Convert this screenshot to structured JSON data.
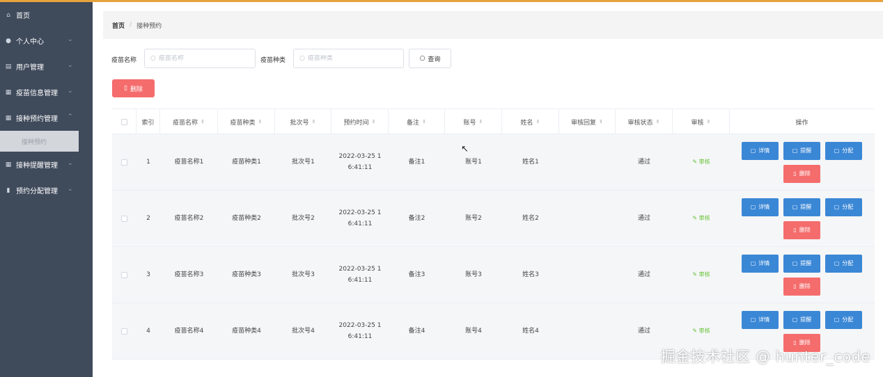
{
  "sidebar": {
    "items": [
      {
        "label": "首页",
        "icon": "home-icon",
        "glyph": "⌂",
        "has_chevron": false
      },
      {
        "label": "个人中心",
        "icon": "user-icon",
        "glyph": "●",
        "has_chevron": true
      },
      {
        "label": "用户管理",
        "icon": "list-icon",
        "glyph": "▤",
        "has_chevron": true
      },
      {
        "label": "疫苗信息管理",
        "icon": "grid-icon",
        "glyph": "▦",
        "has_chevron": true
      },
      {
        "label": "接种预约管理",
        "icon": "grid-icon",
        "glyph": "▦",
        "has_chevron": true,
        "expanded": true
      },
      {
        "label": "接种预约",
        "submenu": true,
        "active": true
      },
      {
        "label": "接种提醒管理",
        "icon": "grid-icon",
        "glyph": "▦",
        "has_chevron": true
      },
      {
        "label": "预约分配管理",
        "icon": "bar-chart-icon",
        "glyph": "▮",
        "has_chevron": true
      }
    ],
    "chevron": "⌄"
  },
  "breadcrumb": {
    "home": "首页",
    "separator": "/",
    "current": "接种预约"
  },
  "search": {
    "name_label": "疫苗名称",
    "name_placeholder": "疫苗名称",
    "type_label": "疫苗种类",
    "type_placeholder": "疫苗种类",
    "query_label": "查询"
  },
  "toolbar": {
    "delete_label": "删除"
  },
  "table": {
    "columns": [
      "",
      "索引",
      "疫苗名称",
      "疫苗种类",
      "批次号",
      "预约时间",
      "备注",
      "账号",
      "姓名",
      "审核回复",
      "审核状态",
      "审核",
      "操作"
    ],
    "rows": [
      {
        "index": "1",
        "name": "疫苗名称1",
        "type": "疫苗种类1",
        "batch": "批次号1",
        "time1": "2022-03-25 1",
        "time2": "6:41:11",
        "note": "备注1",
        "account": "账号1",
        "person": "姓名1",
        "reply": "",
        "status": "通过",
        "audit": "审核"
      },
      {
        "index": "2",
        "name": "疫苗名称2",
        "type": "疫苗种类2",
        "batch": "批次号2",
        "time1": "2022-03-25 1",
        "time2": "6:41:11",
        "note": "备注2",
        "account": "账号2",
        "person": "姓名2",
        "reply": "",
        "status": "通过",
        "audit": "审核"
      },
      {
        "index": "3",
        "name": "疫苗名称3",
        "type": "疫苗种类3",
        "batch": "批次号3",
        "time1": "2022-03-25 1",
        "time2": "6:41:11",
        "note": "备注3",
        "account": "账号3",
        "person": "姓名3",
        "reply": "",
        "status": "通过",
        "audit": "审核"
      },
      {
        "index": "4",
        "name": "疫苗名称4",
        "type": "疫苗种类4",
        "batch": "批次号4",
        "time1": "2022-03-25 1",
        "time2": "6:41:11",
        "note": "备注4",
        "account": "账号4",
        "person": "姓名4",
        "reply": "",
        "status": "通过",
        "audit": "审核"
      }
    ],
    "actions": {
      "detail": "详情",
      "remind": "提醒",
      "assign": "分配",
      "delete": "删除"
    }
  },
  "watermark": "掘金技术社区 @ hunter_code",
  "colors": {
    "sidebar": "#3f4a5b",
    "primary": "#3a87d6",
    "danger": "#f56c6c",
    "success": "#67c23a",
    "top_accent": "#e6a23c"
  }
}
